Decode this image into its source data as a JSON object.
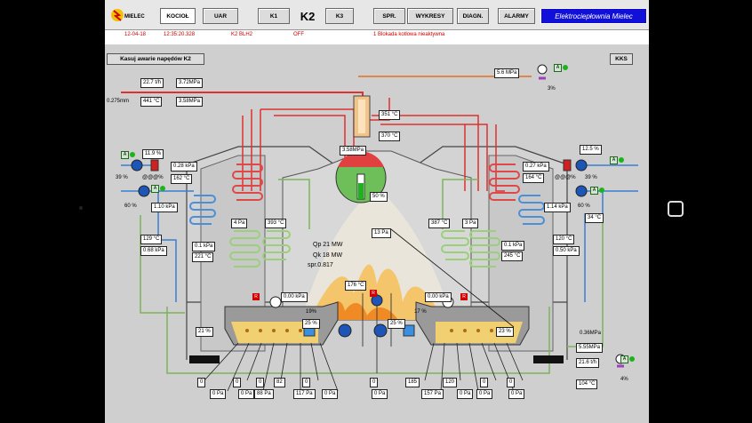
{
  "toolbar": {
    "logo_text": "MIELEC",
    "buttons": [
      "KOCIOŁ",
      "UAR",
      "K1",
      "K2",
      "K3",
      "SPR.",
      "WYKRESY",
      "DIAGN.",
      "ALARMY"
    ],
    "plant_name": "Elektrociepłownia Mielec"
  },
  "alarm": {
    "date": "12-04-18",
    "time": "12:35:20.328",
    "source": "K2  BLH2",
    "state": "OFF",
    "message": "1  Blokada kotłowa nieaktywna"
  },
  "panel": {
    "reset_button": "Kasuj awarie napędów K2",
    "kks_button": "KKS"
  },
  "readings": {
    "steam_flow": "22.7 t/h",
    "steam_pressure": "3.72MPa",
    "steam_prefix": "0.275mm",
    "steam_temp": "441 °C",
    "steam_pressure2": "3.58MPa",
    "top_right_pressure": "5.6 MPa",
    "top_right_pct": "3%",
    "attemp_temp1": "351 °C",
    "attemp_temp2": "370 °C",
    "drum_pressure": "3.58MPa",
    "drum_level": "50 %",
    "left_fan_pct": "11.9 %",
    "left_fan_pressure": "0.28 kPa",
    "left_fan_speed_pct": "39 %",
    "left_fan_flow": "@@@%",
    "left_fan_temp": "162 °C",
    "left_pump_pct": "60 %",
    "left_pump_pressure": "1.10 kPa",
    "right_fan_pct": "12.5 %",
    "right_fan_pressure": "0.27 kPa",
    "right_fan_temp": "164 °C",
    "right_fan_flow": "@@@%",
    "right_fan_speed_pct": "39 %",
    "right_pump_pressure": "1.14 kPa",
    "right_pump_pct": "60 %",
    "right_pump_temp": "34 °C",
    "left_furnace_pa": "4  Pa",
    "left_furnace_temp": "393 °C",
    "right_furnace_temp": "387 °C",
    "right_furnace_pa": "3  Pa",
    "right_draft": "13  Pa",
    "center_qp": "Qp 21 MW",
    "center_qk": "Qk 18 MW",
    "center_spr": "spr.0.817",
    "left_air_temp": "129 °C",
    "left_air_pressure": "0.68 kPa",
    "left_air_pressure2": "0.1  kPa",
    "left_air_temp2": "221 °C",
    "right_air_pressure": "0.1  kPa",
    "right_air_temp": "245 °C",
    "right_air_temp2": "120 °C",
    "right_air_pressure2": "0.50 kPa",
    "left_grate_pressure": "0.00 kPa",
    "left_grate_pct": "19%",
    "center_temp": "176 °C",
    "right_grate_pressure": "0.00 kPa",
    "right_grate_pct": "17 %",
    "left_feed_pct": "25 %",
    "right_feed_pct": "25 %",
    "left_grate_level": "21  %",
    "right_grate_level": "23  %",
    "water_pressure": "0.36MPa",
    "water_pressure2": "5.55MPa",
    "water_flow": "21.6 t/h",
    "water_temp": "104 °C",
    "water_pct": "4%"
  },
  "zones_left": [
    "0",
    "0 Pa",
    "0",
    "0 Pa",
    "0",
    "88 Pa",
    "82",
    "117 Pa",
    "0",
    "0 Pa",
    "0",
    "0 Pa"
  ],
  "zones_right": [
    "0",
    "0 Pa",
    "185",
    "157 Pa",
    "120",
    "0 Pa",
    "0",
    "0 Pa",
    "0",
    "0 Pa"
  ]
}
